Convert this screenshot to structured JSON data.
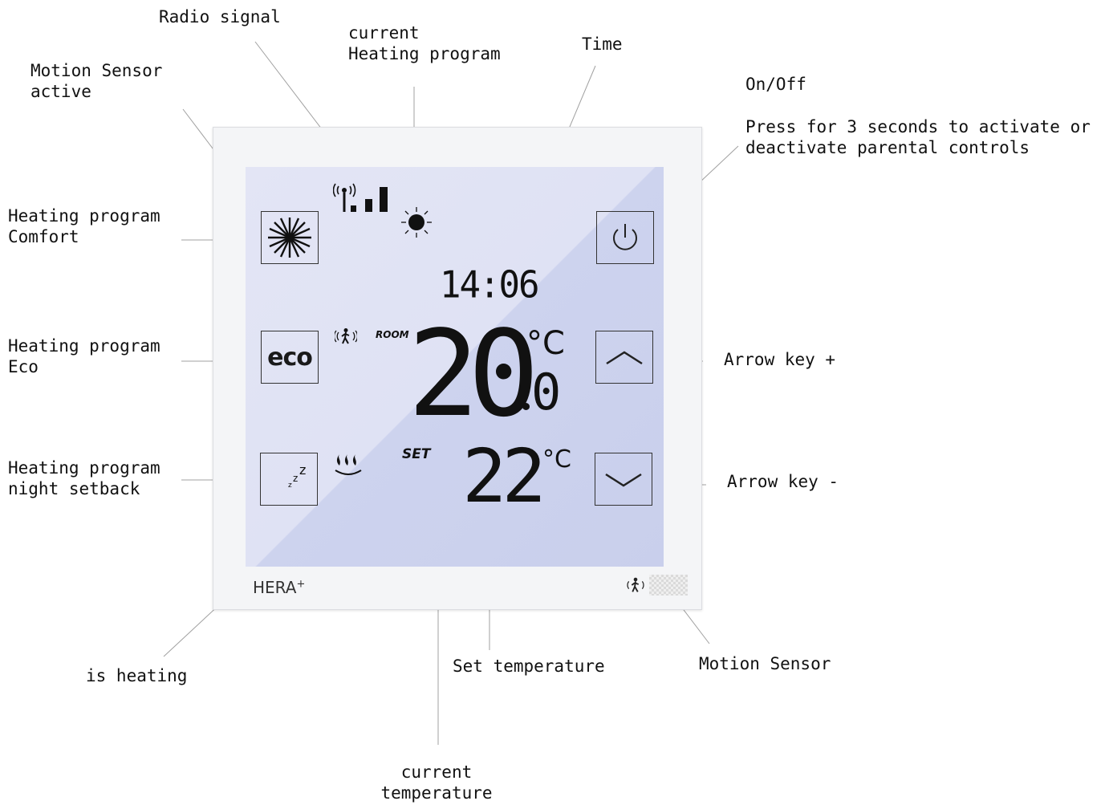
{
  "callouts": {
    "radio_signal": "Radio signal",
    "current_program": [
      "current",
      "Heating program"
    ],
    "time": "Time",
    "motion_active": [
      "Motion Sensor",
      "active"
    ],
    "onoff": "On/Off",
    "parental": [
      "Press for 3 seconds to activate or",
      "deactivate parental controls"
    ],
    "comfort": [
      "Heating program",
      "Comfort"
    ],
    "eco": [
      "Heating program",
      "Eco"
    ],
    "night": [
      "Heating program",
      "night setback"
    ],
    "arrow_plus": "Arrow key +",
    "arrow_minus": "Arrow key -",
    "is_heating": "is heating",
    "set_temperature": "Set temperature",
    "motion_sensor": "Motion Sensor",
    "current_temperature": [
      "current",
      "temperature"
    ]
  },
  "display": {
    "time": "14:06",
    "room_label": "ROOM",
    "room_temp_int": "20",
    "room_temp_dec": "0",
    "unit": "°C",
    "set_label": "SET",
    "set_temp": "22",
    "eco_key": "eco",
    "brand": "HERA",
    "brand_sup": "+"
  },
  "icons": {
    "comfort_key": "asterisk-sun-icon",
    "eco_key": "eco-icon",
    "night_key": "moon-sleep-icon",
    "power_key": "power-icon",
    "up_key": "chevron-up-icon",
    "down_key": "chevron-down-icon",
    "radio": "signal-bars-icon",
    "program": "sun-icon",
    "motion": "walking-person-icon",
    "heating": "heat-waves-icon"
  },
  "colors": {
    "screen": "#dfe2f4",
    "screen_shade": "#cdd3ee",
    "frame": "#f4f5f7",
    "lines": "#999999"
  }
}
